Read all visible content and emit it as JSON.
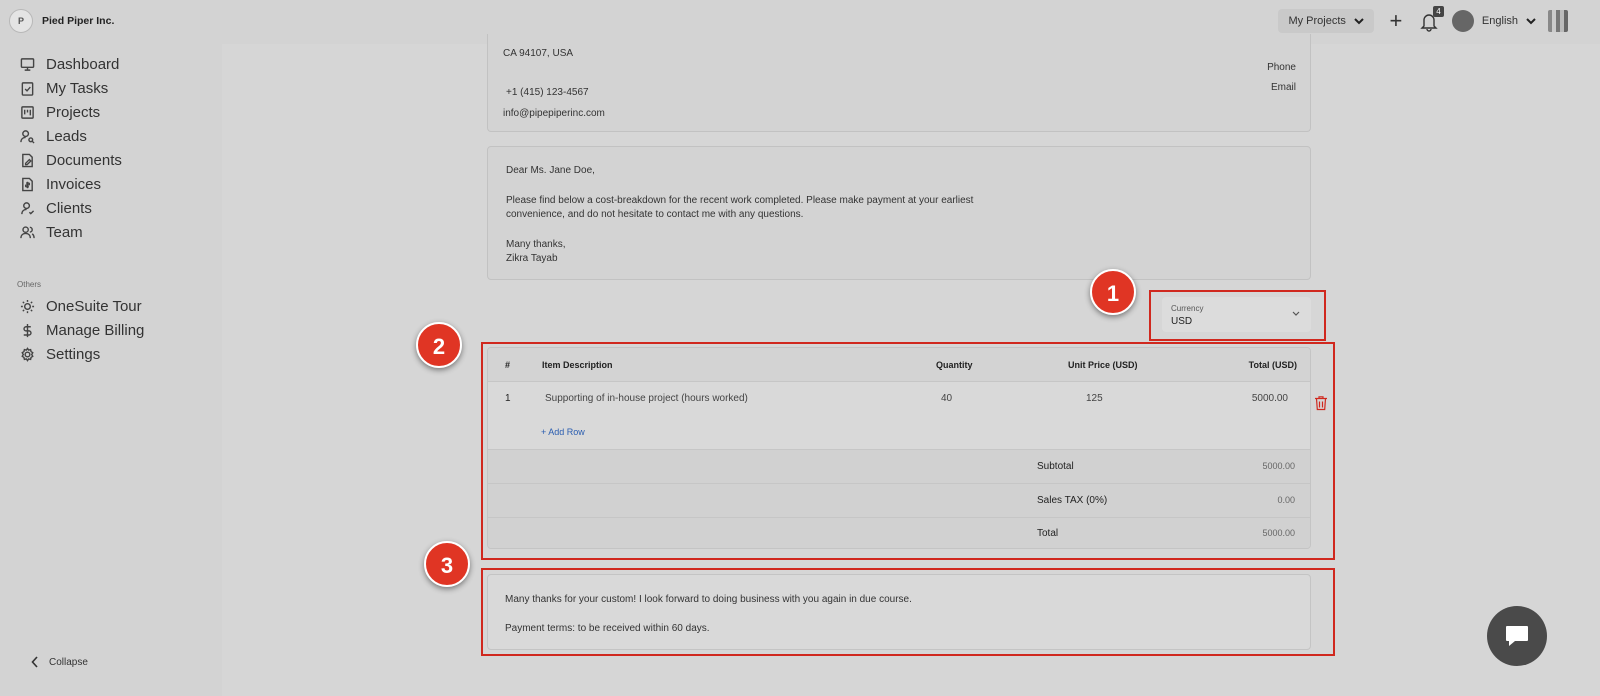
{
  "header": {
    "org_name": "Pied Piper Inc.",
    "logo_text": "P",
    "my_projects_label": "My Projects",
    "notifications_count": "4",
    "language": "English"
  },
  "sidebar": {
    "items": [
      {
        "label": "Dashboard",
        "icon": "dashboard-icon"
      },
      {
        "label": "My Tasks",
        "icon": "tasks-icon"
      },
      {
        "label": "Projects",
        "icon": "projects-icon"
      },
      {
        "label": "Leads",
        "icon": "leads-icon"
      },
      {
        "label": "Documents",
        "icon": "documents-icon"
      },
      {
        "label": "Invoices",
        "icon": "invoices-icon"
      },
      {
        "label": "Clients",
        "icon": "clients-icon"
      },
      {
        "label": "Team",
        "icon": "team-icon"
      }
    ],
    "others_label": "Others",
    "other_items": [
      {
        "label": "OneSuite Tour",
        "icon": "sun-icon"
      },
      {
        "label": "Manage Billing",
        "icon": "dollar-icon"
      },
      {
        "label": "Settings",
        "icon": "gear-icon"
      }
    ],
    "collapse_label": "Collapse"
  },
  "address": {
    "line": "CA 94107, USA",
    "phone": "+1 (415) 123-4567",
    "email": "info@pipepiperinc.com",
    "phone_label": "Phone",
    "email_label": "Email"
  },
  "letter": {
    "salutation": "Dear  Ms. Jane Doe,",
    "body_line1": "Please find below a cost-breakdown for the recent work completed. Please make payment at your earliest",
    "body_line2": "convenience, and do not hesitate to contact me with any questions.",
    "signoff": "Many thanks,",
    "signature": "Zikra Tayab"
  },
  "currency": {
    "label": "Currency",
    "value": "USD"
  },
  "table": {
    "headers": {
      "num": "#",
      "description": "Item Description",
      "quantity": "Quantity",
      "unit_price": "Unit Price  (USD)",
      "total": "Total  (USD)"
    },
    "rows": [
      {
        "num": "1",
        "description": "Supporting of in-house project (hours worked)",
        "quantity": "40",
        "unit_price": "125",
        "total": "5000.00"
      }
    ],
    "add_row": "+ Add Row",
    "subtotal_label": "Subtotal",
    "subtotal": "5000.00",
    "tax_label": "Sales TAX (0%)",
    "tax": "0.00",
    "total_label": "Total",
    "total": "5000.00"
  },
  "notes": {
    "line1": "Many thanks for your custom! I look forward to doing business with you again in due course.",
    "line2": "Payment terms: to be received within 60 days."
  },
  "markers": [
    "1",
    "2",
    "3"
  ],
  "colors": {
    "highlight": "#d0281e",
    "marker": "#e03524",
    "link": "#2a5db0"
  }
}
